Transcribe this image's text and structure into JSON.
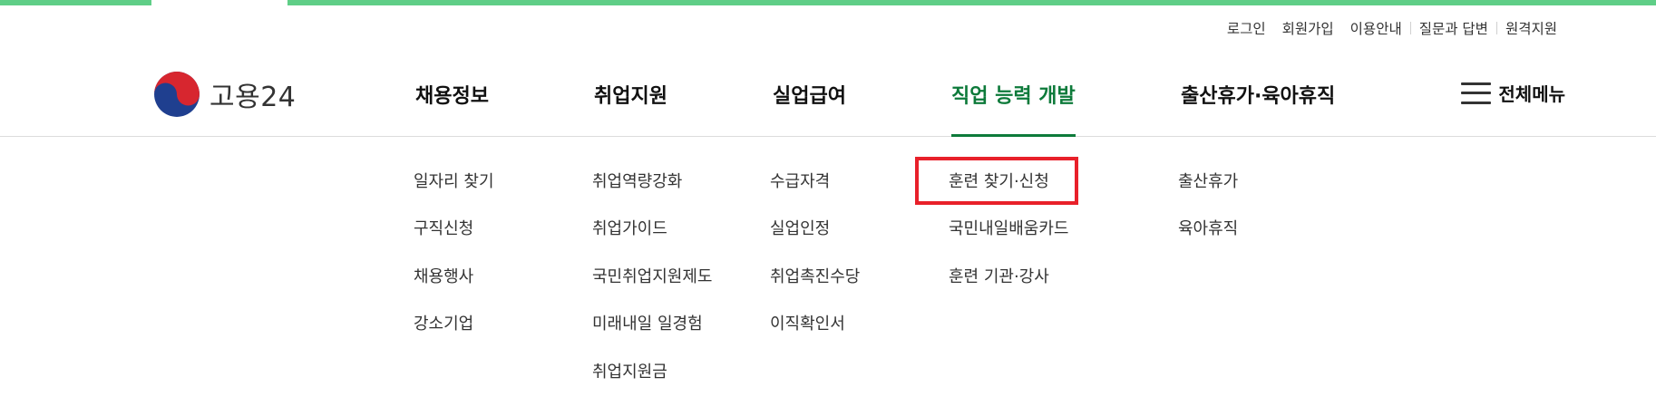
{
  "utility_links": [
    "로그인",
    "회원가입",
    "이용안내",
    "질문과 답변",
    "원격지원"
  ],
  "logo": {
    "text": "고용24",
    "icon": "taegeuk-emblem-icon"
  },
  "gnb": [
    {
      "label": "채용정보"
    },
    {
      "label": "취업지원"
    },
    {
      "label": "실업급여"
    },
    {
      "label": "직업 능력 개발",
      "active": true
    },
    {
      "label": "출산휴가·육아휴직"
    }
  ],
  "all_menu": {
    "label": "전체메뉴",
    "icon": "hamburger-icon"
  },
  "submenus": [
    [
      "일자리 찾기",
      "구직신청",
      "채용행사",
      "강소기업"
    ],
    [
      "취업역량강화",
      "취업가이드",
      "국민취업지원제도",
      "미래내일 일경험",
      "취업지원금"
    ],
    [
      "수급자격",
      "실업인정",
      "취업촉진수당",
      "이직확인서"
    ],
    [
      "훈련 찾기·신청",
      "국민내일배움카드",
      "훈련 기관·강사"
    ],
    [
      "출산휴가",
      "육아휴직"
    ]
  ],
  "highlighted_item": "훈련 찾기·신청",
  "colors": {
    "top_bar": "#5fce87",
    "active_menu": "#0d7a3a",
    "highlight_box": "#e8202a"
  }
}
